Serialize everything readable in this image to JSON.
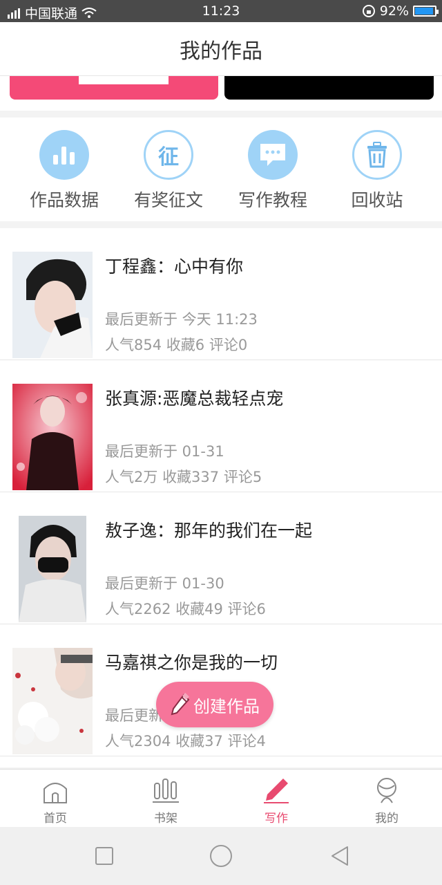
{
  "status_bar": {
    "carrier": "中国联通",
    "time": "11:23",
    "battery": "92%",
    "battery_level": 0.92
  },
  "header": {
    "title": "我的作品"
  },
  "quick_entries": [
    {
      "label": "作品数据",
      "icon": "bar-chart-icon"
    },
    {
      "label": "有奖征文",
      "icon": "contest-icon",
      "glyph": "征"
    },
    {
      "label": "写作教程",
      "icon": "chat-bubble-icon"
    },
    {
      "label": "回收站",
      "icon": "trash-icon"
    }
  ],
  "works": [
    {
      "title": "丁程鑫：心中有你",
      "updated": "最后更新于 今天 11:23",
      "popularity": "人气854",
      "favorites": "收藏6",
      "comments": "评论0"
    },
    {
      "title": "张真源:恶魔总裁轻点宠",
      "updated": "最后更新于 01-31",
      "popularity": "人气2万",
      "favorites": "收藏337",
      "comments": "评论5"
    },
    {
      "title": "敖子逸：那年的我们在一起",
      "updated": "最后更新于 01-30",
      "popularity": "人气2262",
      "favorites": "收藏49",
      "comments": "评论6"
    },
    {
      "title": "马嘉祺之你是我的一切",
      "updated": "最后更新",
      "popularity": "人气2304",
      "favorites": "收藏37",
      "comments": "评论4"
    }
  ],
  "fab": {
    "label": "创建作品"
  },
  "tabs": [
    {
      "label": "首页"
    },
    {
      "label": "书架"
    },
    {
      "label": "写作"
    },
    {
      "label": "我的"
    }
  ],
  "colors": {
    "accent": "#e84a6f",
    "icon_blue": "#9fd3f7",
    "fab": "#f6759a"
  }
}
